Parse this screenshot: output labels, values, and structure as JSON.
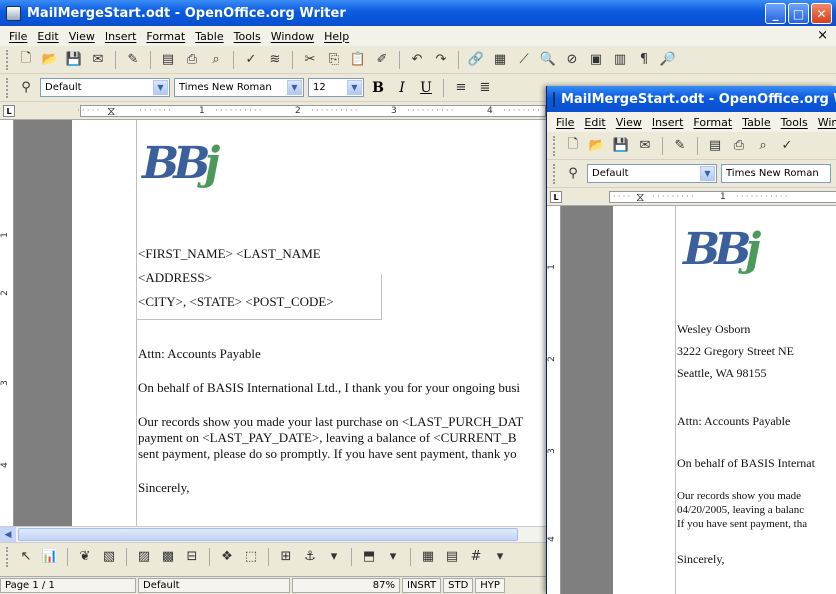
{
  "main_window": {
    "title": "MailMergeStart.odt - OpenOffice.org Writer",
    "menu": [
      "File",
      "Edit",
      "View",
      "Insert",
      "Format",
      "Table",
      "Tools",
      "Window",
      "Help"
    ],
    "menu_close": "×",
    "style_combo": "Default",
    "font_combo": "Times New Roman",
    "size_combo": "12",
    "bold": "B",
    "italic": "I",
    "underline": "U",
    "ruler_numbers": [
      "1",
      "2",
      "3",
      "4"
    ],
    "vruler_numbers": [
      "1",
      "2",
      "3",
      "4"
    ],
    "document": {
      "address_lines": [
        "<FIRST_NAME>  <LAST_NAME",
        "<ADDRESS>",
        "<CITY>, <STATE> <POST_CODE>"
      ],
      "attn": "Attn: Accounts Payable",
      "para1": "On behalf of BASIS International Ltd., I thank you for your ongoing busi",
      "para2_lines": [
        "Our records show you made your last purchase on <LAST_PURCH_DAT",
        "payment on <LAST_PAY_DATE>, leaving a balance of <CURRENT_B",
        "sent payment, please do so promptly. If you have sent payment, thank yo"
      ],
      "closing": "Sincerely,"
    },
    "status": {
      "page": "Page 1 / 1",
      "style": "Default",
      "zoom": "87%",
      "insert": "INSRT",
      "std": "STD",
      "hyp": "HYP"
    }
  },
  "second_window": {
    "title": "MailMergeStart.odt - OpenOffice.org Writer",
    "menu": [
      "File",
      "Edit",
      "View",
      "Insert",
      "Format",
      "Table",
      "Tools",
      "Window"
    ],
    "style_combo": "Default",
    "font_combo": "Times New Roman",
    "ruler_numbers": [
      "1"
    ],
    "vruler_numbers": [
      "1",
      "2",
      "3",
      "4"
    ],
    "document": {
      "address_lines": [
        "Wesley Osborn",
        "3222 Gregory Street NE",
        "Seattle, WA 98155"
      ],
      "attn": "Attn: Accounts Payable",
      "para1": "On behalf of BASIS Internat",
      "para2_lines": [
        "Our records show you made",
        "04/20/2005, leaving a balanc",
        "If you have sent payment, tha"
      ],
      "closing": "Sincerely,"
    }
  },
  "logo_text": "BBj",
  "colors": {
    "titlebar": "#0a5be0",
    "page_bg": "#7f7f7f",
    "logo_blue": "#3a5f9a",
    "logo_green": "#4c9a5b"
  }
}
